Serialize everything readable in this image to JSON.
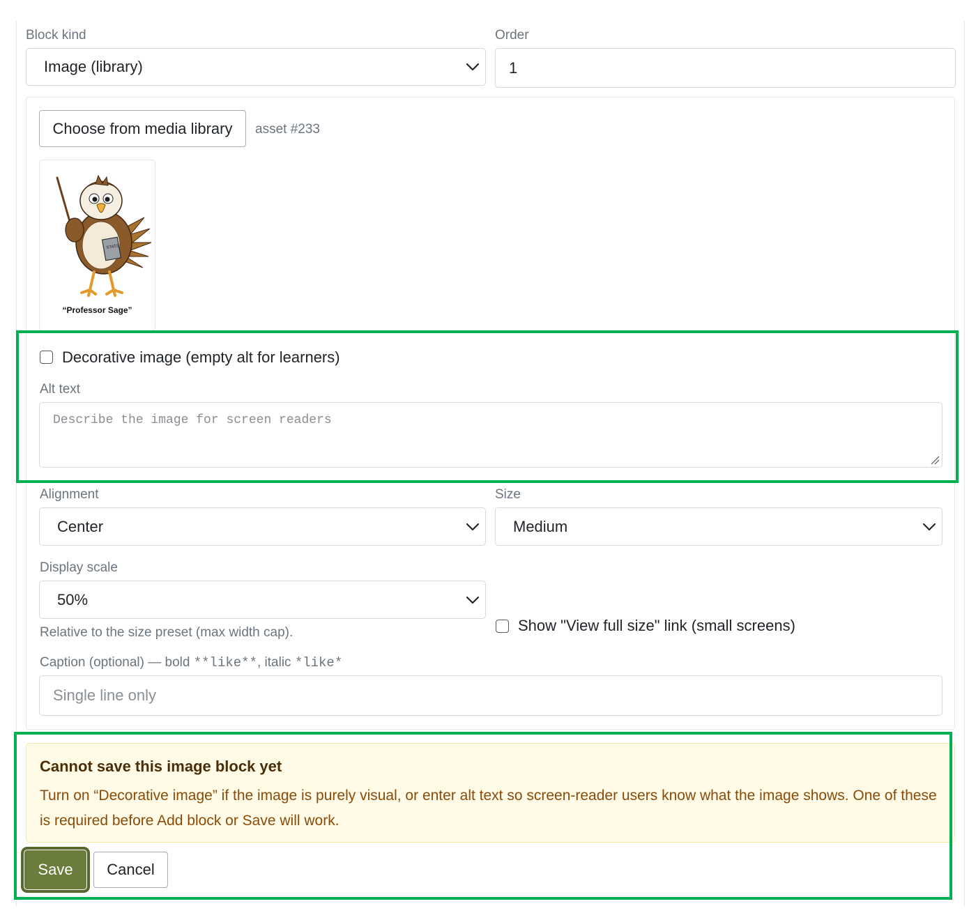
{
  "block_kind": {
    "label": "Block kind",
    "selected": "Image (library)"
  },
  "order": {
    "label": "Order",
    "value": "1"
  },
  "media": {
    "choose_label": "Choose from media library",
    "asset_id": "asset #233",
    "thumbnail_caption": "“Professor Sage”",
    "thumbnail_book_text": "STATS"
  },
  "decorative": {
    "label": "Decorative image (empty alt for learners)",
    "checked": false
  },
  "alt_text": {
    "label": "Alt text",
    "placeholder": "Describe the image for screen readers"
  },
  "alignment": {
    "label": "Alignment",
    "selected": "Center"
  },
  "size": {
    "label": "Size",
    "selected": "Medium"
  },
  "display_scale": {
    "label": "Display scale",
    "selected": "50%",
    "help": "Relative to the size preset (max width cap)."
  },
  "full_size_link": {
    "label": "Show \"View full size\" link (small screens)",
    "checked": false
  },
  "caption": {
    "label_prefix": "Caption (optional) — bold ",
    "bold_example": "**like**",
    "label_mid": ", italic ",
    "italic_example": "*like*",
    "placeholder": "Single line only"
  },
  "alert": {
    "title": "Cannot save this image block yet",
    "body": "Turn on “Decorative image” if the image is purely visual, or enter alt text so screen-reader users know what the image shows. One of these is required before Add block or Save will work."
  },
  "actions": {
    "save_label": "Save",
    "cancel_label": "Cancel"
  },
  "colors": {
    "highlight": "#00b050",
    "save_button": "#6b7d3a",
    "alert_background": "#fffbe6",
    "alert_text": "#8a4b0a"
  }
}
